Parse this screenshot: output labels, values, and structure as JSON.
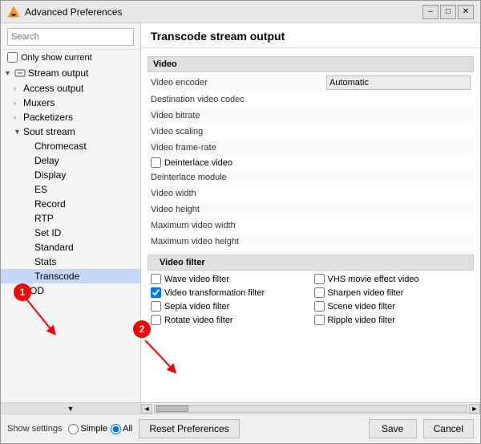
{
  "window": {
    "title": "Advanced Preferences",
    "minimize_label": "–",
    "maximize_label": "□",
    "close_label": "✕"
  },
  "sidebar": {
    "search_placeholder": "Search",
    "only_show_current_label": "Only show current",
    "items": [
      {
        "id": "stream-output",
        "label": "Stream output",
        "level": 0,
        "has_arrow": true,
        "expanded": true,
        "has_icon": true
      },
      {
        "id": "access-output",
        "label": "Access output",
        "level": 1,
        "has_arrow": true,
        "expanded": false,
        "has_icon": false
      },
      {
        "id": "muxers",
        "label": "Muxers",
        "level": 1,
        "has_arrow": true,
        "expanded": false,
        "has_icon": false
      },
      {
        "id": "packetizers",
        "label": "Packetizers",
        "level": 1,
        "has_arrow": true,
        "expanded": false,
        "has_icon": false
      },
      {
        "id": "sout-stream",
        "label": "Sout stream",
        "level": 1,
        "has_arrow": true,
        "expanded": true,
        "has_icon": false
      },
      {
        "id": "chromecast",
        "label": "Chromecast",
        "level": 2,
        "has_arrow": false,
        "expanded": false,
        "has_icon": false
      },
      {
        "id": "delay",
        "label": "Delay",
        "level": 2,
        "has_arrow": false,
        "expanded": false,
        "has_icon": false
      },
      {
        "id": "display",
        "label": "Display",
        "level": 2,
        "has_arrow": false,
        "expanded": false,
        "has_icon": false
      },
      {
        "id": "es",
        "label": "ES",
        "level": 2,
        "has_arrow": false,
        "expanded": false,
        "has_icon": false
      },
      {
        "id": "record",
        "label": "Record",
        "level": 2,
        "has_arrow": false,
        "expanded": false,
        "has_icon": false
      },
      {
        "id": "rtp",
        "label": "RTP",
        "level": 2,
        "has_arrow": false,
        "expanded": false,
        "has_icon": false
      },
      {
        "id": "set-id",
        "label": "Set ID",
        "level": 2,
        "has_arrow": false,
        "expanded": false,
        "has_icon": false
      },
      {
        "id": "standard",
        "label": "Standard",
        "level": 2,
        "has_arrow": false,
        "expanded": false,
        "has_icon": false
      },
      {
        "id": "stats",
        "label": "Stats",
        "level": 2,
        "has_arrow": false,
        "expanded": false,
        "has_icon": false
      },
      {
        "id": "transcode",
        "label": "Transcode",
        "level": 2,
        "has_arrow": false,
        "expanded": false,
        "has_icon": false,
        "selected": true
      },
      {
        "id": "vod",
        "label": "VOD",
        "level": 1,
        "has_arrow": true,
        "expanded": false,
        "has_icon": false
      }
    ]
  },
  "main": {
    "title": "Transcode stream output",
    "sections": [
      {
        "id": "video",
        "label": "Video",
        "settings": [
          {
            "id": "video-encoder",
            "label": "Video encoder",
            "type": "input",
            "value": "Automatic"
          },
          {
            "id": "dest-video-codec",
            "label": "Destination video codec",
            "type": "text",
            "value": ""
          },
          {
            "id": "video-bitrate",
            "label": "Video bitrate",
            "type": "text",
            "value": ""
          },
          {
            "id": "video-scaling",
            "label": "Video scaling",
            "type": "text",
            "value": ""
          },
          {
            "id": "video-framerate",
            "label": "Video frame-rate",
            "type": "text",
            "value": ""
          },
          {
            "id": "deinterlace-video",
            "label": "Deinterlace video",
            "type": "checkbox",
            "checked": false
          },
          {
            "id": "deinterlace-module",
            "label": "Deinterlace module",
            "type": "text",
            "value": ""
          },
          {
            "id": "video-width",
            "label": "Video width",
            "type": "text",
            "value": ""
          },
          {
            "id": "video-height",
            "label": "Video height",
            "type": "text",
            "value": ""
          },
          {
            "id": "max-video-width",
            "label": "Maximum video width",
            "type": "text",
            "value": ""
          },
          {
            "id": "max-video-height",
            "label": "Maximum video height",
            "type": "text",
            "value": ""
          }
        ]
      },
      {
        "id": "video-filter",
        "label": "Video filter",
        "checkboxes": [
          {
            "id": "wave-video",
            "label": "Wave video filter",
            "checked": false
          },
          {
            "id": "vhs-movie",
            "label": "VHS movie effect video",
            "checked": false
          },
          {
            "id": "video-transform",
            "label": "Video transformation filter",
            "checked": true
          },
          {
            "id": "sharpen-video",
            "label": "Sharpen video filter",
            "checked": false
          },
          {
            "id": "sepia-video",
            "label": "Sepia video filter",
            "checked": false
          },
          {
            "id": "scene-video",
            "label": "Scene video filter",
            "checked": false
          },
          {
            "id": "rotate-video",
            "label": "Rotate video filter",
            "checked": false
          },
          {
            "id": "ripple-video",
            "label": "Ripple video filter",
            "checked": false
          }
        ]
      }
    ]
  },
  "bottom": {
    "show_settings_label": "Show settings",
    "simple_label": "Simple",
    "all_label": "All",
    "reset_label": "Reset Preferences",
    "save_label": "Save",
    "cancel_label": "Cancel"
  },
  "annotations": [
    {
      "id": "1",
      "label": "1"
    },
    {
      "id": "2",
      "label": "2"
    }
  ]
}
